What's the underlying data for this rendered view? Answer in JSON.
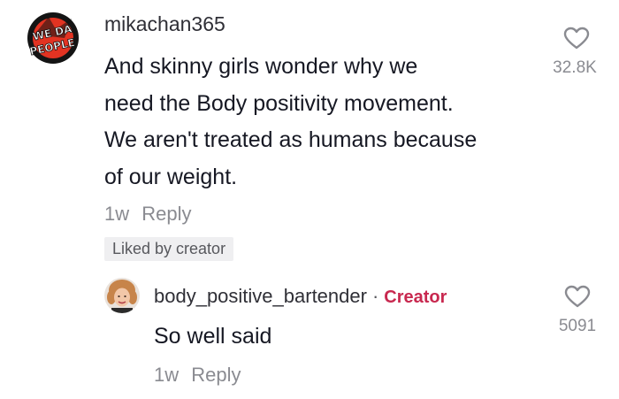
{
  "comment": {
    "username": "mikachan365",
    "avatar_text": "WE DA PEOPLE",
    "text_lines": [
      "And skinny girls wonder why we",
      "need the Body positivity movement.",
      "We aren't treated as humans because",
      "of our weight."
    ],
    "time": "1w",
    "reply_label": "Reply",
    "badge": "Liked by creator",
    "like_count": "32.8K"
  },
  "reply": {
    "username": "body_positive_bartender",
    "separator": "·",
    "creator_label": "Creator",
    "text": "So well said",
    "time": "1w",
    "reply_label": "Reply",
    "like_count": "5091"
  },
  "colors": {
    "creator": "#c8284f",
    "muted": "#8a8b91",
    "text": "#161823",
    "badge_bg": "#efeff1"
  }
}
